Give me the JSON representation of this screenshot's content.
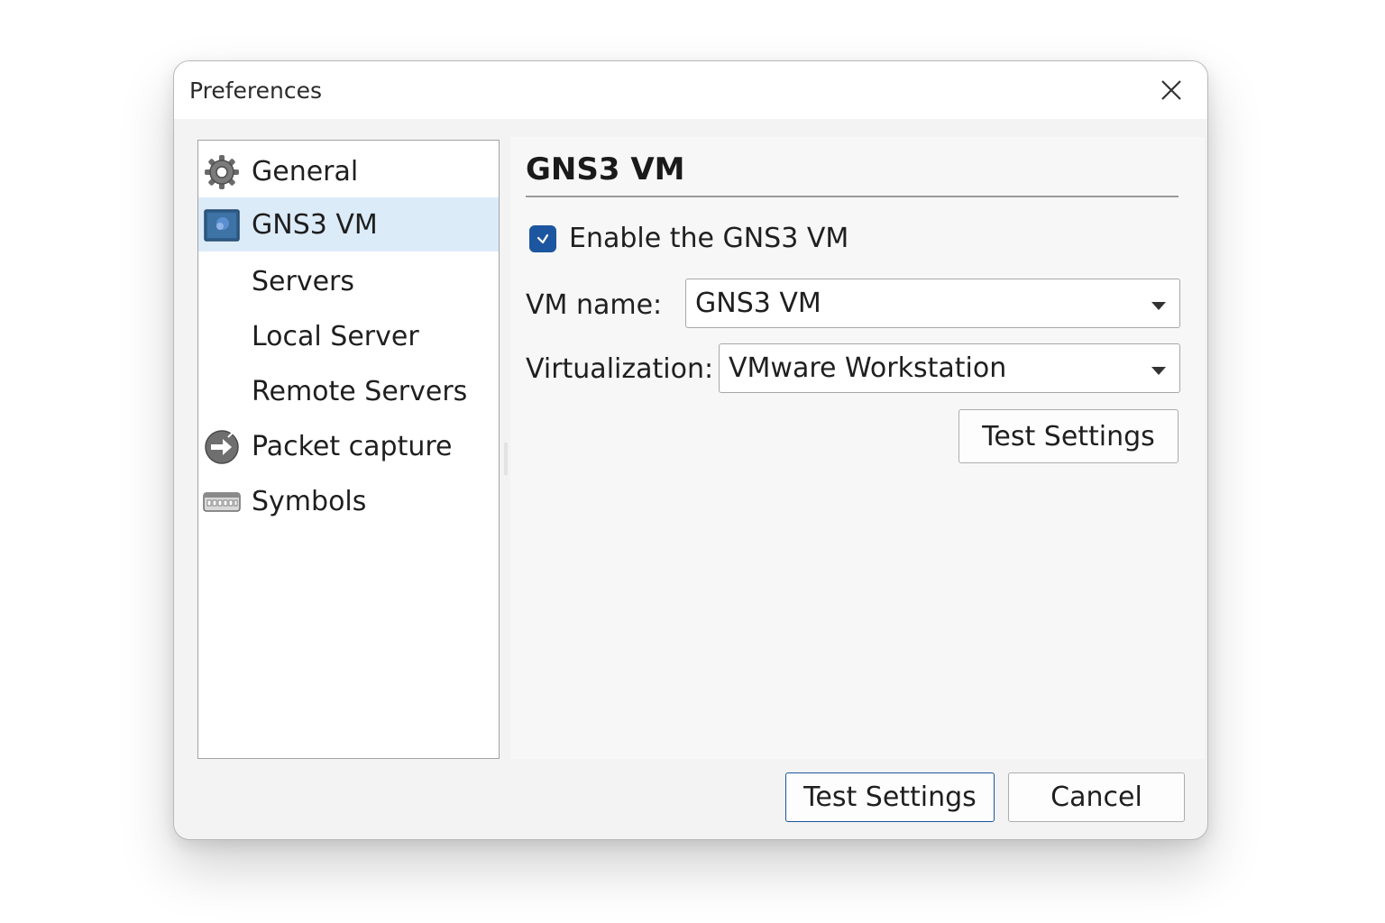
{
  "window": {
    "title": "Preferences",
    "close_icon": "close-icon"
  },
  "sidebar": {
    "items": [
      {
        "label": "General",
        "icon": "gear-icon",
        "selected": false
      },
      {
        "label": "GNS3 VM",
        "icon": "gns3-vm-icon",
        "selected": true
      },
      {
        "label": "Servers",
        "icon": "",
        "selected": false
      },
      {
        "label": "Local Server",
        "icon": "",
        "selected": false
      },
      {
        "label": "Remote Servers",
        "icon": "",
        "selected": false
      },
      {
        "label": "Packet capture",
        "icon": "packet-capture-icon",
        "selected": false
      },
      {
        "label": "Symbols",
        "icon": "symbols-icon",
        "selected": false
      }
    ]
  },
  "panel": {
    "title": "GNS3 VM",
    "enable_checkbox": {
      "label": "Enable the GNS3 VM",
      "checked": true
    },
    "vm_name": {
      "label": "VM name:",
      "value": "GNS3 VM"
    },
    "virtualization": {
      "label": "Virtualization:",
      "value": "VMware Workstation"
    },
    "test_settings_label": "Test Settings"
  },
  "footer": {
    "test_settings_label": "Test Settings",
    "cancel_label": "Cancel"
  },
  "colors": {
    "accent": "#1c56a0",
    "selection": "#dcebf8",
    "dialog_bg": "#f3f3f3"
  }
}
